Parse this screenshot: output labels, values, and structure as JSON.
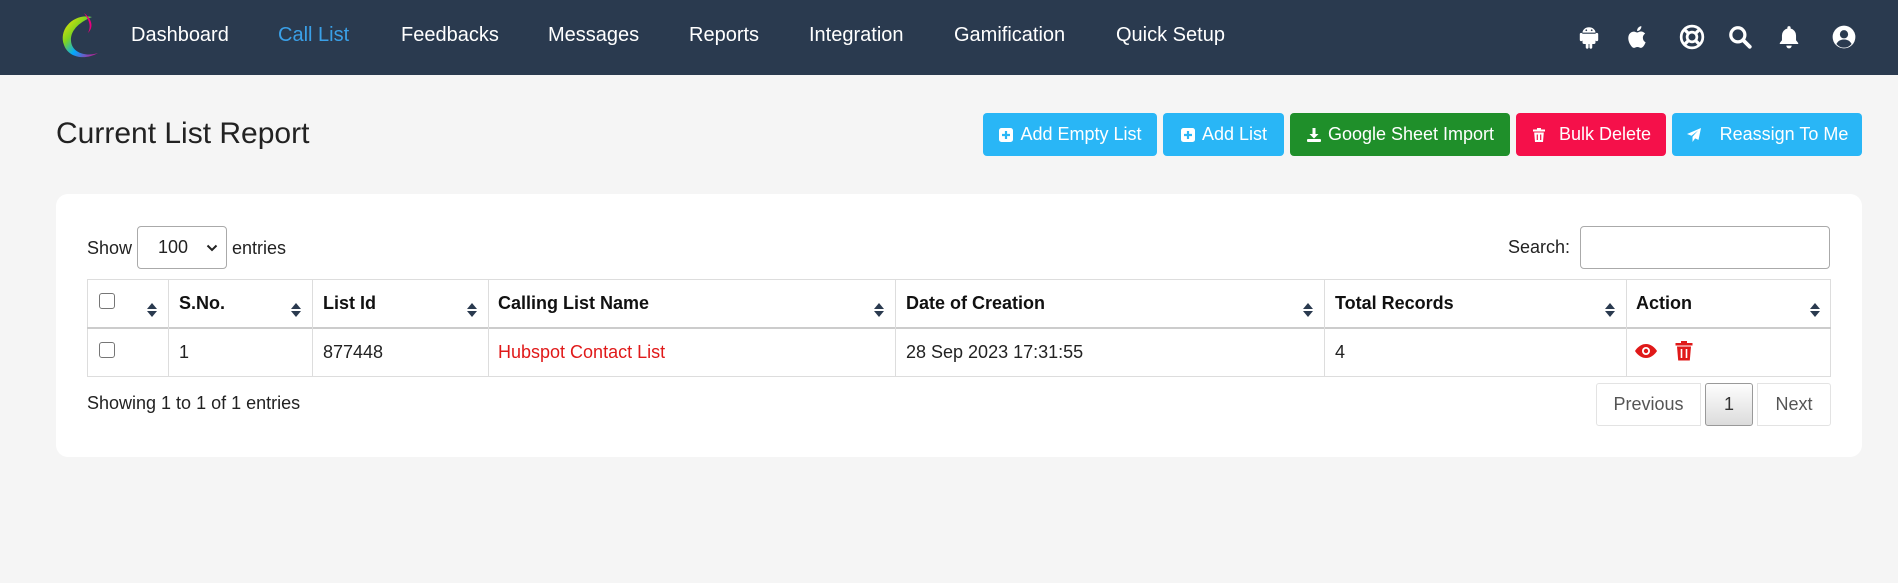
{
  "nav": {
    "items": [
      {
        "label": "Dashboard",
        "active": false
      },
      {
        "label": "Call List",
        "active": true
      },
      {
        "label": "Feedbacks",
        "active": false
      },
      {
        "label": "Messages",
        "active": false
      },
      {
        "label": "Reports",
        "active": false
      },
      {
        "label": "Integration",
        "active": false
      },
      {
        "label": "Gamification",
        "active": false
      },
      {
        "label": "Quick Setup",
        "active": false
      }
    ],
    "icons": [
      "android-icon",
      "apple-icon",
      "lifebuoy-icon",
      "search-icon",
      "bell-icon",
      "user-circle-icon"
    ],
    "colors": {
      "bar": "#2a3a4f",
      "active": "#3aa0e8"
    }
  },
  "page": {
    "title": "Current List Report"
  },
  "toolbar": {
    "add_empty_list": "Add Empty List",
    "add_list": "Add List",
    "google_sheet_import": "Google Sheet Import",
    "bulk_delete": "Bulk Delete",
    "reassign_to_me": "Reassign To Me"
  },
  "controls": {
    "show_label": "Show",
    "entries_label": "entries",
    "length_value": "100",
    "search_label": "Search:",
    "search_value": ""
  },
  "table": {
    "columns": [
      "S.No.",
      "List Id",
      "Calling List Name",
      "Date of Creation",
      "Total Records",
      "Action"
    ],
    "rows": [
      {
        "sno": "1",
        "list_id": "877448",
        "name": "Hubspot Contact List",
        "date": "28 Sep 2023 17:31:55",
        "total": "4"
      }
    ]
  },
  "footer": {
    "info": "Showing 1 to 1 of 1 entries",
    "previous": "Previous",
    "page": "1",
    "next": "Next"
  }
}
